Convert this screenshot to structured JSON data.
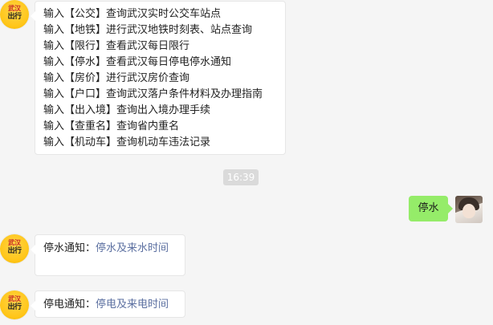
{
  "menu": {
    "lines": [
      {
        "prefix": "输入",
        "key": "【公交】",
        "desc": "查询武汉实时公交车站点"
      },
      {
        "prefix": "输入",
        "key": "【地铁】",
        "desc": "进行武汉地铁时刻表、站点查询"
      },
      {
        "prefix": "输入",
        "key": "【限行】",
        "desc": "查看武汉每日限行"
      },
      {
        "prefix": "输入",
        "key": "【停水】",
        "desc": "查看武汉每日停电停水通知"
      },
      {
        "prefix": "输入",
        "key": "【房价】",
        "desc": "进行武汉房价查询"
      },
      {
        "prefix": "输入",
        "key": "【户口】",
        "desc": "查询武汉落户条件材料及办理指南"
      },
      {
        "prefix": "输入",
        "key": "【出入境】",
        "desc": "查询出入境办理手续"
      },
      {
        "prefix": "输入",
        "key": "【查重名】",
        "desc": "查询省内重名"
      },
      {
        "prefix": "输入",
        "key": "【机动车】",
        "desc": "查询机动车违法记录"
      }
    ]
  },
  "timestamp": "16:39",
  "user_message": "停水",
  "bot_avatar": {
    "line1": "武汉",
    "line2": "出行"
  },
  "notices": [
    {
      "label": "停水通知：",
      "link": "停水及来水时间"
    },
    {
      "label": "停电通知：",
      "link": "停电及来电时间"
    }
  ]
}
